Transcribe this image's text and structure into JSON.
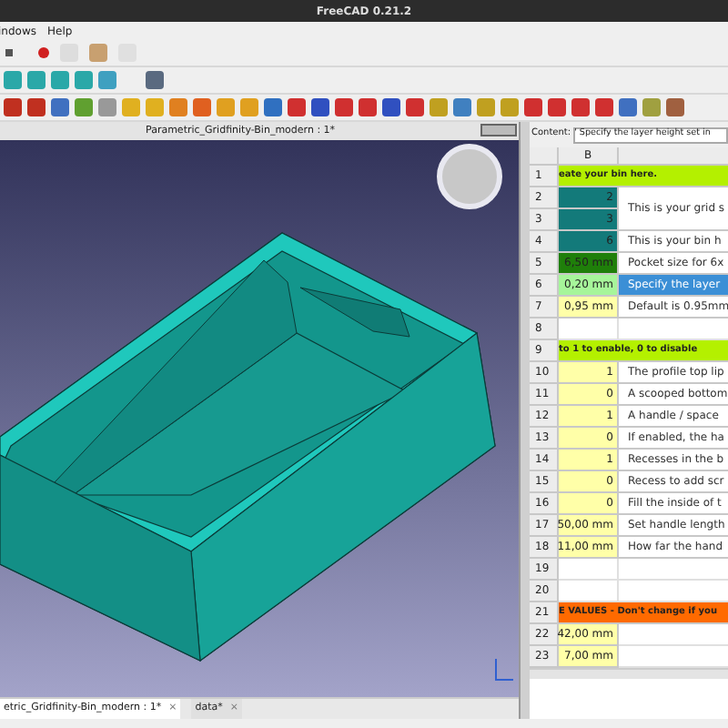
{
  "window": {
    "title": "FreeCAD 0.21.2"
  },
  "menu": [
    "indows",
    "Help"
  ],
  "document": {
    "title": "Parametric_Gridfinity-Bin_modern : 1*"
  },
  "spreadsheet": {
    "content_label": "Content:",
    "content_value": "'  Specify the layer height set in",
    "column_header": "B",
    "rows": [
      {
        "number": "1",
        "kind": "banner",
        "color": "#b4f000",
        "text": "eate your bin here."
      },
      {
        "number": "2",
        "kind": "cell",
        "color": "#137a7a",
        "value": "2",
        "note": "This is your grid s",
        "merged_below": true,
        "selected": false
      },
      {
        "number": "3",
        "kind": "cell",
        "color": "#137a7a",
        "value": "3"
      },
      {
        "number": "4",
        "kind": "cell",
        "color": "#137a7a",
        "value": "6",
        "note": "This is your bin h",
        "selected": false
      },
      {
        "number": "5",
        "kind": "cell",
        "color": "#1f7f0a",
        "value": "6,50 mm",
        "note": "Pocket size for 6x",
        "selected": false
      },
      {
        "number": "6",
        "kind": "cell",
        "color": "#a6f59a",
        "value": "0,20 mm",
        "note": "Specify the layer",
        "selected": true
      },
      {
        "number": "7",
        "kind": "cell",
        "color": "#ffffa8",
        "value": "0,95 mm",
        "note": "Default is 0.95mm",
        "selected": false
      },
      {
        "number": "8",
        "kind": "empty"
      },
      {
        "number": "9",
        "kind": "banner",
        "color": "#b4f000",
        "text": "to 1 to enable, 0 to disable"
      },
      {
        "number": "10",
        "kind": "cell",
        "color": "#ffffa8",
        "value": "1",
        "note": "The profile top lip",
        "selected": false
      },
      {
        "number": "11",
        "kind": "cell",
        "color": "#ffffa8",
        "value": "0",
        "note": "A scooped bottom",
        "selected": false
      },
      {
        "number": "12",
        "kind": "cell",
        "color": "#ffffa8",
        "value": "1",
        "note": "A handle / space",
        "selected": false
      },
      {
        "number": "13",
        "kind": "cell",
        "color": "#ffffa8",
        "value": "0",
        "note": "If enabled, the ha",
        "selected": false
      },
      {
        "number": "14",
        "kind": "cell",
        "color": "#ffffa8",
        "value": "1",
        "note": "Recesses in the b",
        "selected": false
      },
      {
        "number": "15",
        "kind": "cell",
        "color": "#ffffa8",
        "value": "0",
        "note": "Recess to add scr",
        "selected": false
      },
      {
        "number": "16",
        "kind": "cell",
        "color": "#ffffa8",
        "value": "0",
        "note": "Fill the inside of t",
        "selected": false
      },
      {
        "number": "17",
        "kind": "cell",
        "color": "#ffffa8",
        "value": "50,00 mm",
        "note": "Set handle length",
        "selected": false
      },
      {
        "number": "18",
        "kind": "cell",
        "color": "#ffffa8",
        "value": "11,00 mm",
        "note": "How far the hand",
        "selected": false
      },
      {
        "number": "19",
        "kind": "empty"
      },
      {
        "number": "20",
        "kind": "empty"
      },
      {
        "number": "21",
        "kind": "banner",
        "color": "#ff6a00",
        "text": "E VALUES - Don't change if you"
      },
      {
        "number": "22",
        "kind": "cell",
        "color": "#ffffa8",
        "value": "42,00 mm",
        "selected": false
      },
      {
        "number": "23",
        "kind": "cell",
        "color": "#ffffa8",
        "value": "7,00 mm",
        "selected": false
      }
    ]
  },
  "tabs": [
    {
      "label": "etric_Gridfinity-Bin_modern : 1*",
      "close": "×",
      "selected": true
    },
    {
      "label": "data*",
      "close": "×",
      "selected": false
    }
  ]
}
